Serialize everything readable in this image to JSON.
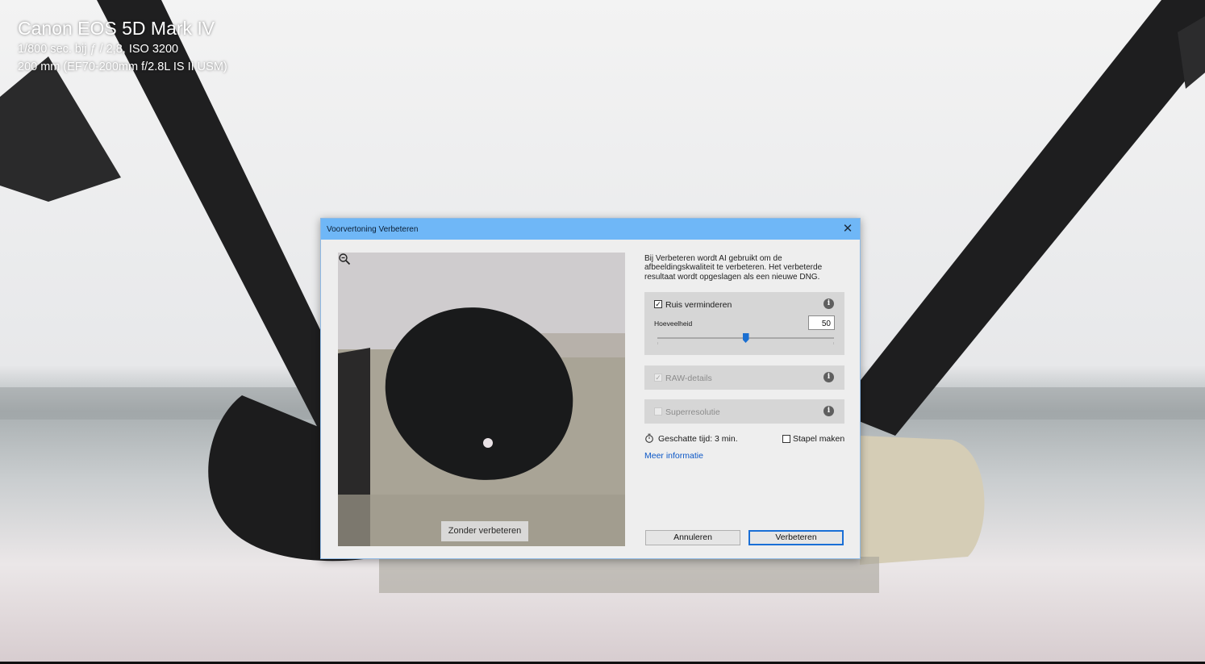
{
  "photo_info": {
    "camera": "Canon EOS 5D Mark IV",
    "exposure": "1/800 sec. bij ƒ / 2,8, ISO 3200",
    "lens": "200 mm (EF70-200mm f/2.8L IS II USM)"
  },
  "dialog": {
    "title": "Voorvertoning Verbeteren",
    "description": "Bij Verbeteren wordt AI gebruikt om de afbeeldingskwaliteit te verbeteren. Het verbeterde resultaat wordt opgeslagen als een nieuwe DNG.",
    "preview": {
      "compare_button": "Zonder verbeteren",
      "zoom_icon": "zoom-icon"
    },
    "noise_reduction": {
      "label": "Ruis verminderen",
      "checked": true,
      "amount_label": "Hoeveelheid",
      "amount_value": "50",
      "slider_fraction": 0.5
    },
    "raw_details": {
      "label": "RAW-details",
      "checked": true,
      "disabled": true
    },
    "super_resolution": {
      "label": "Superresolutie",
      "checked": false,
      "disabled": true
    },
    "estimated_time": "Geschatte tijd: 3 min.",
    "stack": {
      "label": "Stapel maken",
      "checked": false
    },
    "more_info": "Meer informatie",
    "buttons": {
      "cancel": "Annuleren",
      "enhance": "Verbeteren"
    },
    "colors": {
      "titlebar": "#6fb7f7",
      "accent": "#1a6fd6",
      "link": "#0b57c7"
    }
  }
}
